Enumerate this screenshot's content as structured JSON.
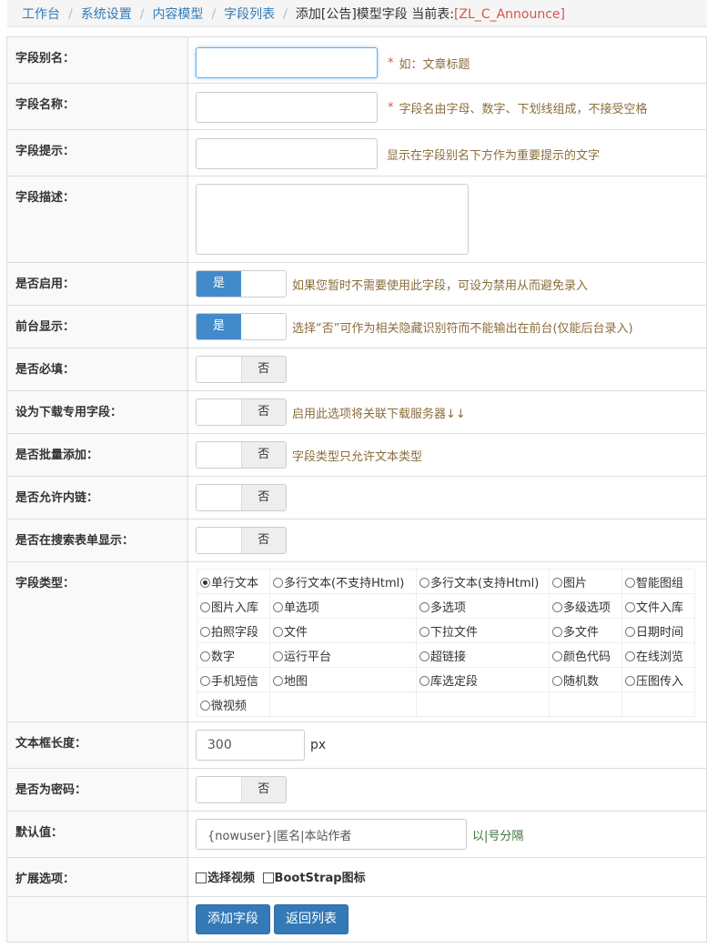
{
  "breadcrumb": {
    "items": [
      "工作台",
      "系统设置",
      "内容模型",
      "字段列表"
    ],
    "current": "添加[公告]模型字段 当前表:",
    "table_name": "[ZL_C_Announce]"
  },
  "fields": {
    "alias": {
      "label": "字段别名：",
      "value": "",
      "req": "*",
      "hint": "如：文章标题"
    },
    "name": {
      "label": "字段名称：",
      "value": "",
      "req": "*",
      "hint": "字段名由字母、数字、下划线组成，不接受空格"
    },
    "tip": {
      "label": "字段提示：",
      "value": "",
      "hint": "显示在字段别名下方作为重要提示的文字"
    },
    "desc": {
      "label": "字段描述：",
      "value": ""
    },
    "enabled": {
      "label": "是否启用：",
      "state": "是",
      "hint": "如果您暂时不需要使用此字段，可设为禁用从而避免录入"
    },
    "front": {
      "label": "前台显示：",
      "state": "是",
      "hint": "选择“否”可作为相关隐藏识别符而不能输出在前台(仅能后台录入)"
    },
    "required": {
      "label": "是否必填：",
      "state": "否"
    },
    "download": {
      "label": "设为下载专用字段：",
      "state": "否",
      "hint": "启用此选项将关联下载服务器↓↓"
    },
    "batch": {
      "label": "是否批量添加：",
      "state": "否",
      "hint": "字段类型只允许文本类型"
    },
    "innerlink": {
      "label": "是否允许内链：",
      "state": "否"
    },
    "search": {
      "label": "是否在搜索表单显示：",
      "state": "否"
    },
    "type": {
      "label": "字段类型：",
      "selected": "单行文本",
      "rows": [
        [
          "单行文本",
          "多行文本(不支持Html)",
          "多行文本(支持Html)",
          "图片",
          "智能图组"
        ],
        [
          "图片入库",
          "单选项",
          "多选项",
          "多级选项",
          "文件入库"
        ],
        [
          "拍照字段",
          "文件",
          "下拉文件",
          "多文件",
          "日期时间"
        ],
        [
          "数字",
          "运行平台",
          "超链接",
          "颜色代码",
          "在线浏览"
        ],
        [
          "手机短信",
          "地图",
          "库选定段",
          "随机数",
          "压图传入"
        ],
        [
          "微视频",
          "",
          "",
          "",
          ""
        ]
      ]
    },
    "width": {
      "label": "文本框长度：",
      "value": "300",
      "unit": "px"
    },
    "password": {
      "label": "是否为密码：",
      "state": "否"
    },
    "default": {
      "label": "默认值：",
      "value": "{nowuser}|匿名|本站作者",
      "hint": "以|号分隔"
    },
    "ext": {
      "label": "扩展选项：",
      "options": [
        "选择视频",
        "BootStrap图标"
      ]
    }
  },
  "actions": {
    "add": "添加字段",
    "back": "返回列表"
  }
}
